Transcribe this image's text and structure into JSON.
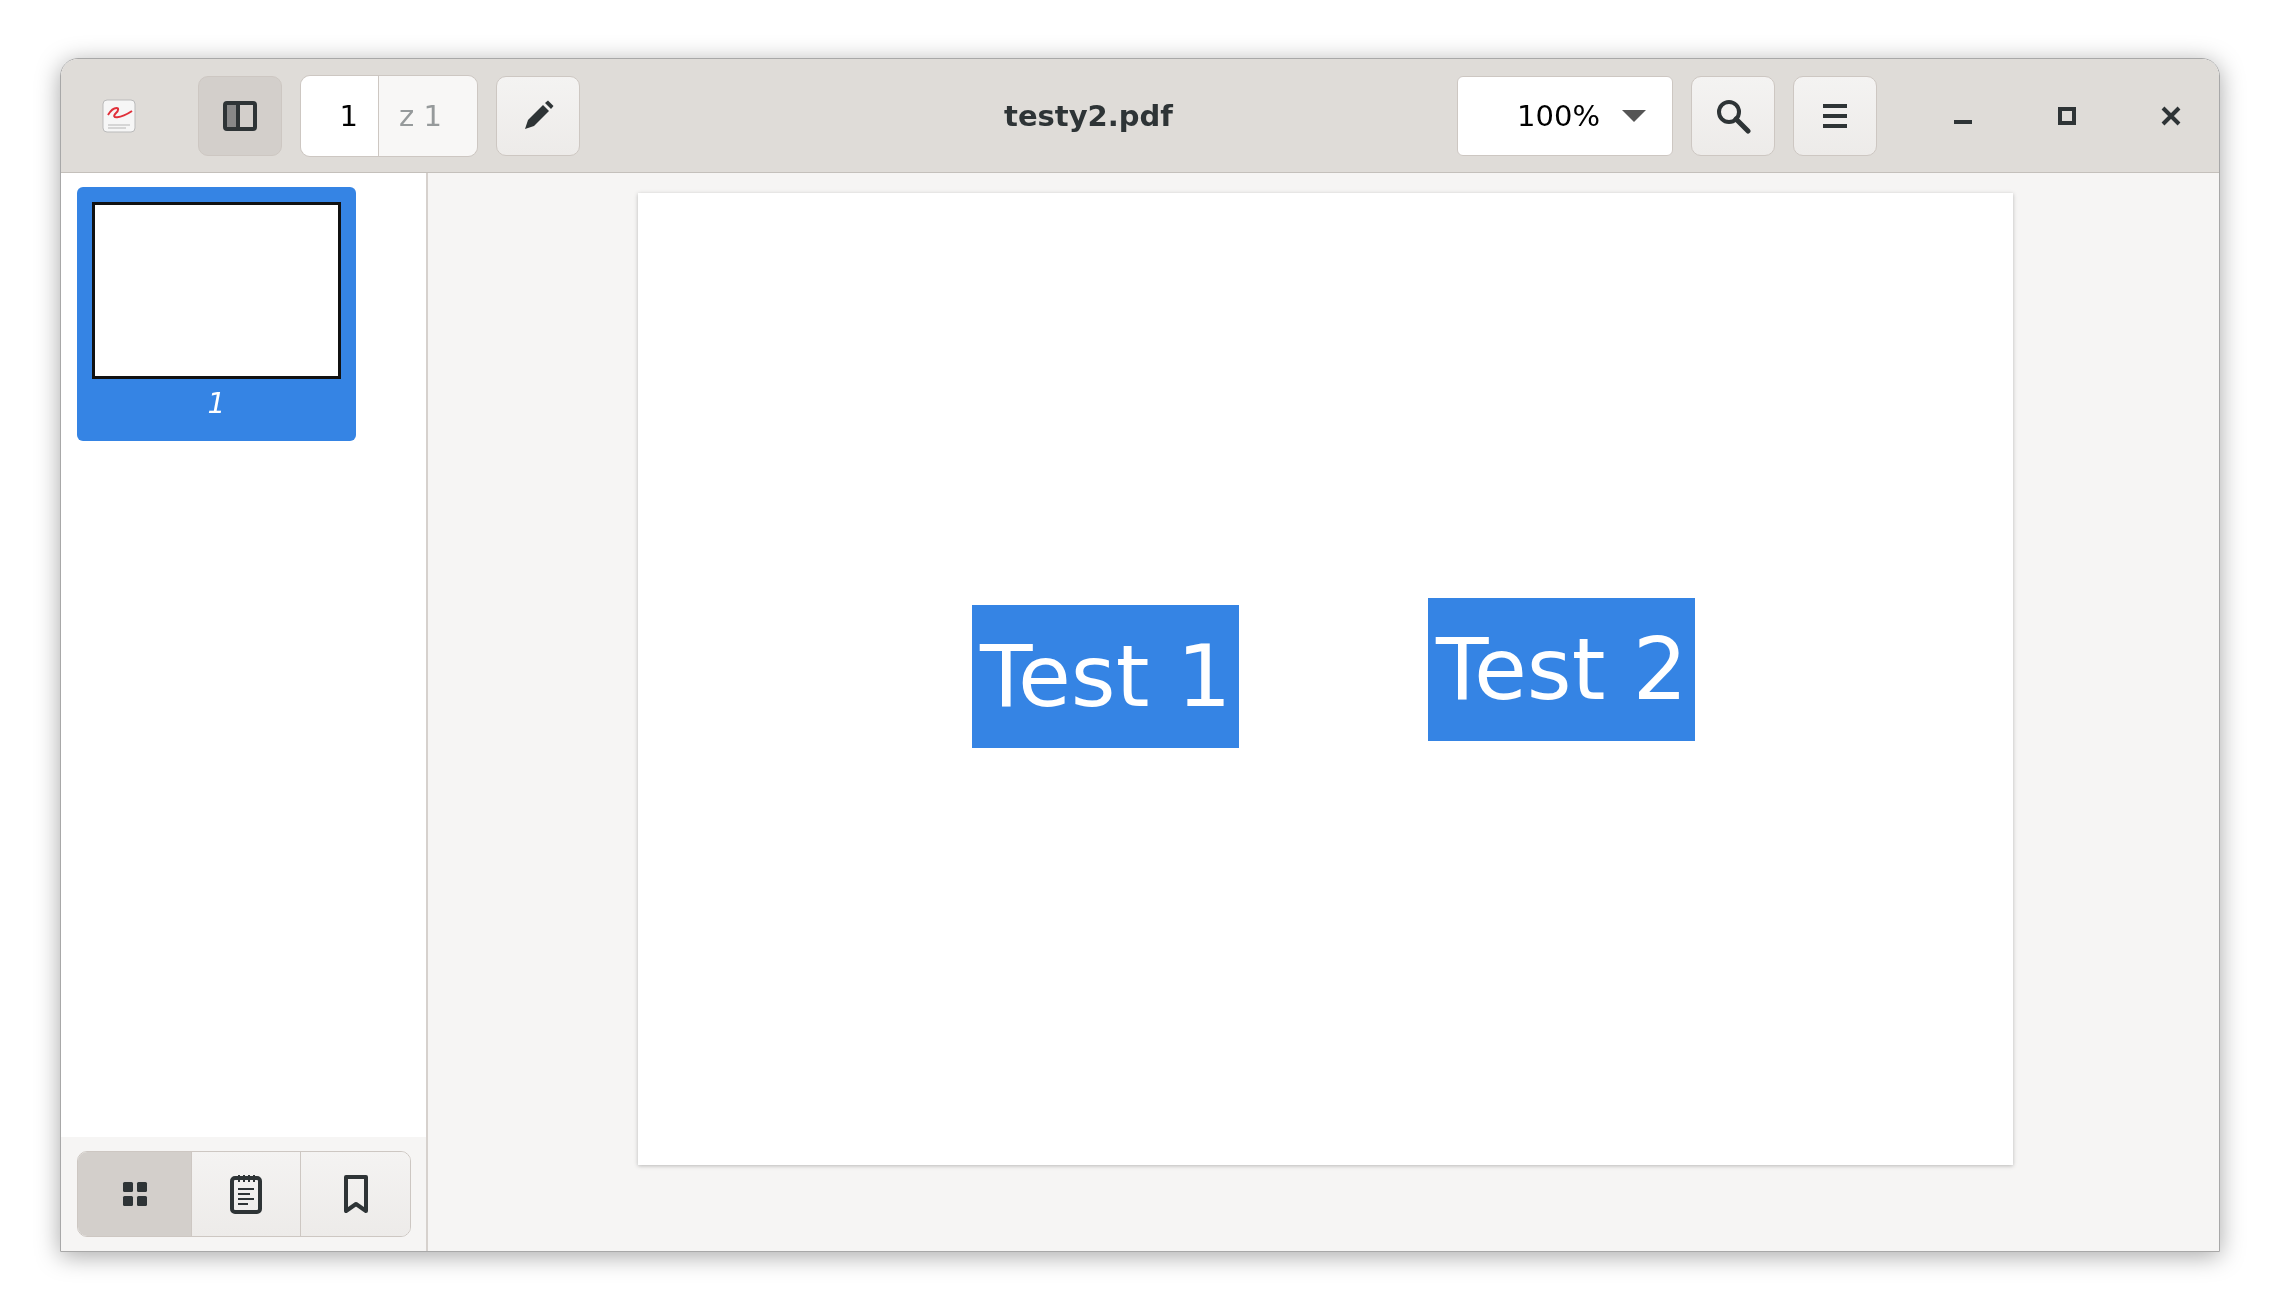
{
  "headerbar": {
    "sidebar_toggle": {
      "selected": true
    },
    "page_entry": {
      "value": "1",
      "total": "z 1"
    },
    "title": "testy2.pdf",
    "zoom": {
      "value": "100%"
    }
  },
  "sidebar": {
    "thumbnails": [
      {
        "label": "1",
        "selected": true
      }
    ],
    "view_tabs": [
      {
        "kind": "thumbnails",
        "selected": true
      },
      {
        "kind": "outline",
        "selected": false
      },
      {
        "kind": "bookmarks",
        "selected": false
      }
    ]
  },
  "document": {
    "highlights": [
      {
        "text": "Test 1"
      },
      {
        "text": "Test 2"
      }
    ]
  }
}
